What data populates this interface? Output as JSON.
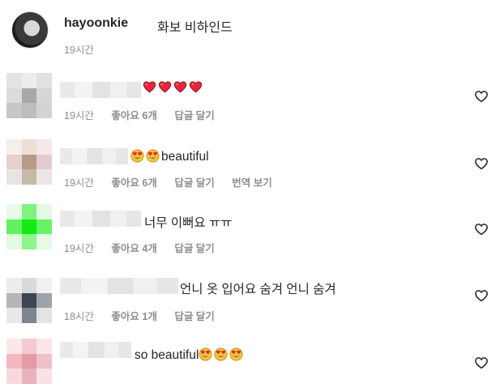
{
  "caption": {
    "username": "hayoonkie",
    "text": "화보 비하인드",
    "time": "19시간"
  },
  "comments": [
    {
      "text": "",
      "emoji_prefix": [
        "red-heart",
        "red-heart",
        "red-heart",
        "red-heart"
      ],
      "time": "19시간",
      "likes": "좋아요 6개",
      "reply": "답글 달기",
      "translate": "",
      "avatar_colors": [
        "#e4e4e4",
        "#ececec",
        "#e1e1e1",
        "#dcdcdc",
        "#a8a8a8",
        "#d6d6d6",
        "#c7c7c7",
        "#bdbdbd",
        "#d3d3d3"
      ]
    },
    {
      "text": "beautiful",
      "emoji_prefix": [
        "heart-eyes",
        "heart-eyes"
      ],
      "time": "19시간",
      "likes": "좋아요 6개",
      "reply": "답글 달기",
      "translate": "번역 보기",
      "avatar_colors": [
        "#f4efec",
        "#eedfd5",
        "#f1e9ea",
        "#e7d0d0",
        "#b79c86",
        "#e4cbd2",
        "#e9e4e4",
        "#c7b9a8",
        "#ece6e6"
      ]
    },
    {
      "text": "너무 이뻐요 ㅠㅠ",
      "emoji_prefix": [],
      "time": "19시간",
      "likes": "좋아요 4개",
      "reply": "답글 달기",
      "translate": "",
      "avatar_colors": [
        "#e8fbe8",
        "#7ef37e",
        "#e4fae4",
        "#5ff25f",
        "#16ea16",
        "#66f366",
        "#e2fae2",
        "#8cf58c",
        "#e5fbe5"
      ]
    },
    {
      "text": "언니 옷 입어요 숨겨 언니 숨겨",
      "emoji_prefix": [],
      "time": "18시간",
      "likes": "좋아요 1개",
      "reply": "답글 달기",
      "translate": "",
      "avatar_colors": [
        "#ececec",
        "#d9d9d9",
        "#f0f0f0",
        "#b6b6b6",
        "#3e4451",
        "#9fa3aa",
        "#e9e9e9",
        "#7d8593",
        "#e3e3e3"
      ]
    },
    {
      "text": "so beautiful",
      "emoji_prefix": [],
      "emoji_suffix": [
        "heart-eyes",
        "heart-eyes",
        "heart-eyes"
      ],
      "time": "",
      "likes": "",
      "reply": "",
      "translate": "",
      "avatar_colors": [
        "#fbe7ea",
        "#f4c9cf",
        "#fbe5e8",
        "#f2b7c0",
        "#e59aa6",
        "#f0c0c7",
        "#f7d9dd",
        "#eab2bb",
        "#f9e1e5"
      ]
    }
  ]
}
